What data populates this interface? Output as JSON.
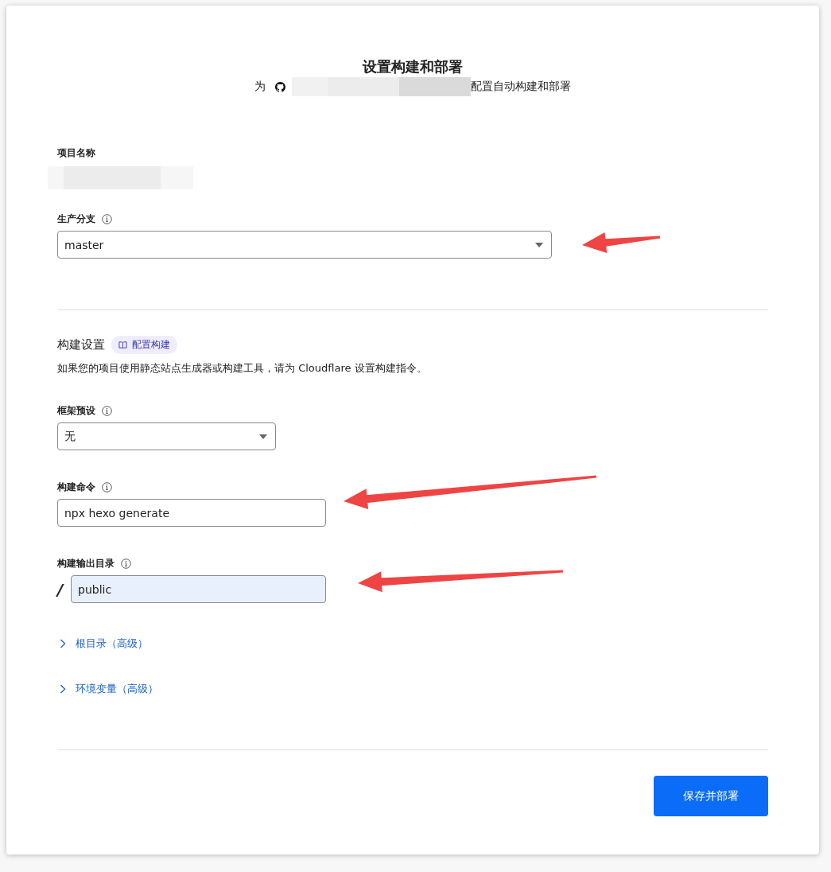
{
  "header": {
    "title": "设置构建和部署",
    "subtitle_prefix": "为",
    "subtitle_suffix": "配置自动构建和部署"
  },
  "project_name": {
    "label": "项目名称"
  },
  "production_branch": {
    "label": "生产分支",
    "value": "master"
  },
  "build_settings": {
    "heading": "构建设置",
    "badge": "配置构建",
    "description": "如果您的项目使用静态站点生成器或构建工具，请为 Cloudflare 设置构建指令。",
    "fields": [
      {
        "kind": "select",
        "label": "框架预设",
        "value": "无"
      },
      {
        "kind": "text",
        "label": "构建命令",
        "value": "npx hexo generate"
      },
      {
        "kind": "path",
        "label": "构建输出目录",
        "prefix": "/",
        "value": "public"
      }
    ],
    "sections": [
      {
        "label": "根目录（高级）",
        "expanded": false
      },
      {
        "label": "环境变量（高级）",
        "expanded": false
      }
    ]
  },
  "save_button": "保存并部署"
}
